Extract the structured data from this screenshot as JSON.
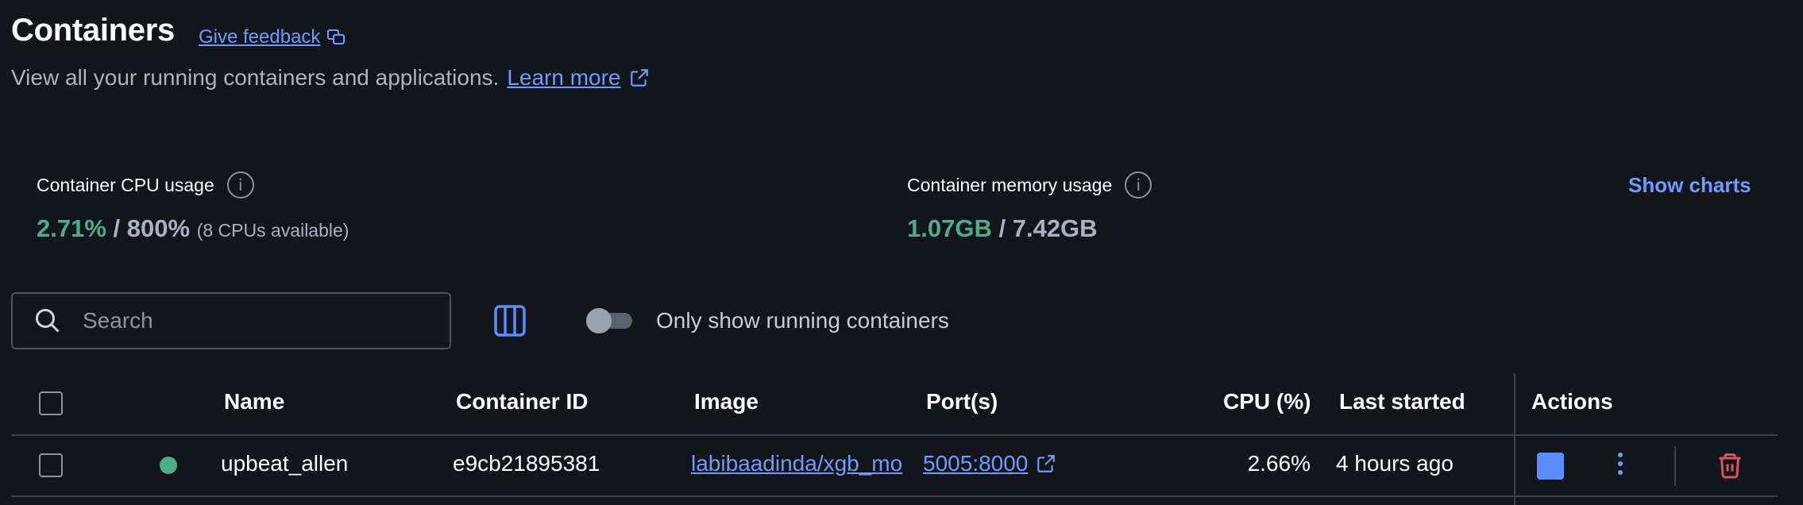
{
  "header": {
    "title": "Containers",
    "feedback_link": "Give feedback",
    "subtitle": "View all your running containers and applications.",
    "learn_more": "Learn more"
  },
  "usage": {
    "cpu": {
      "label": "Container CPU usage",
      "used": "2.71%",
      "separator": "/",
      "total": "800%",
      "note": "(8 CPUs available)"
    },
    "memory": {
      "label": "Container memory usage",
      "used": "1.07GB",
      "separator": "/",
      "total": "7.42GB"
    },
    "show_charts": "Show charts"
  },
  "toolbar": {
    "search_placeholder": "Search",
    "toggle_label": "Only show running containers",
    "toggle_on": false
  },
  "table": {
    "headers": {
      "name": "Name",
      "container_id": "Container ID",
      "image": "Image",
      "ports": "Port(s)",
      "cpu": "CPU (%)",
      "last_started": "Last started",
      "actions": "Actions"
    },
    "rows": [
      {
        "status": "running",
        "name": "upbeat_allen",
        "container_id": "e9cb21895381",
        "image": "labibaadinda/xgb_mo",
        "ports": "5005:8000",
        "cpu": "2.66%",
        "last_started": "4 hours ago"
      }
    ]
  },
  "colors": {
    "background": "#121519",
    "accent": "#6d9bff",
    "running": "#4caf8a",
    "delete": "#e0525f"
  },
  "icons": [
    "feedback-icon",
    "external-link-icon",
    "info-icon",
    "search-icon",
    "columns-icon",
    "stop-icon",
    "more-vert-icon",
    "trash-icon"
  ]
}
